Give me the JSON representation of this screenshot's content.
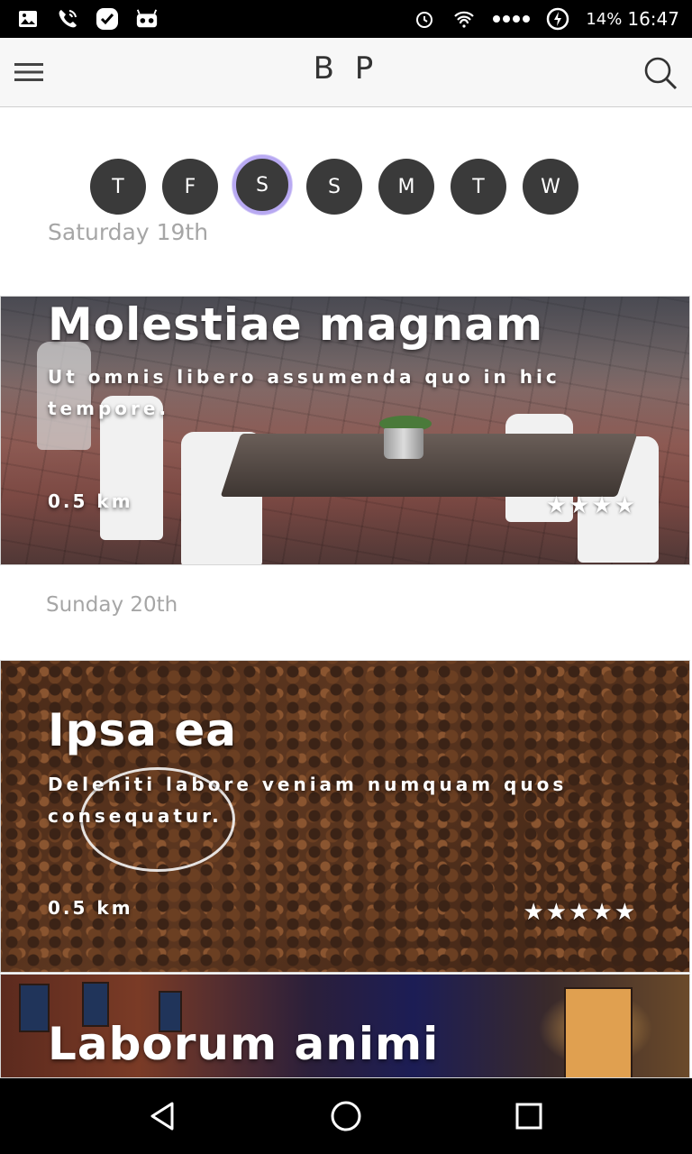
{
  "status_bar": {
    "battery_percent": "14%",
    "time": "16:47",
    "left_icons": [
      "image-icon",
      "phone-wifi-icon",
      "check-bubble-icon",
      "android-icon"
    ],
    "right_icons": [
      "alarm-icon",
      "wifi-icon",
      "signal-dots-icon",
      "battery-charging-icon"
    ]
  },
  "app_bar": {
    "title": "B P",
    "menu_icon": "hamburger-menu-icon",
    "search_icon": "search-icon"
  },
  "day_picker": {
    "days": [
      "T",
      "F",
      "S",
      "S",
      "M",
      "T",
      "W"
    ],
    "selected_index": 2,
    "selected_border_color": "#b8a9f2"
  },
  "sections": [
    {
      "date_label": "Saturday 19th",
      "card": {
        "title": "Molestiae magnam",
        "description": "Ut omnis libero assumenda quo in hic tempore.",
        "distance": "0.5 km",
        "rating": "★★★★",
        "image": "outdoor-cafe-tables"
      }
    },
    {
      "date_label": "Sunday 20th",
      "card": {
        "title": "Ipsa ea",
        "description": "Deleniti labore veniam numquam quos consequatur.",
        "distance": "0.5 km",
        "rating": "★★★★★",
        "image": "coffee-beans"
      }
    },
    {
      "card": {
        "title": "Laborum animi",
        "image": "night-street"
      }
    }
  ],
  "nav_bar": {
    "back_icon": "back-triangle-icon",
    "home_icon": "home-circle-icon",
    "recents_icon": "recents-square-icon"
  }
}
